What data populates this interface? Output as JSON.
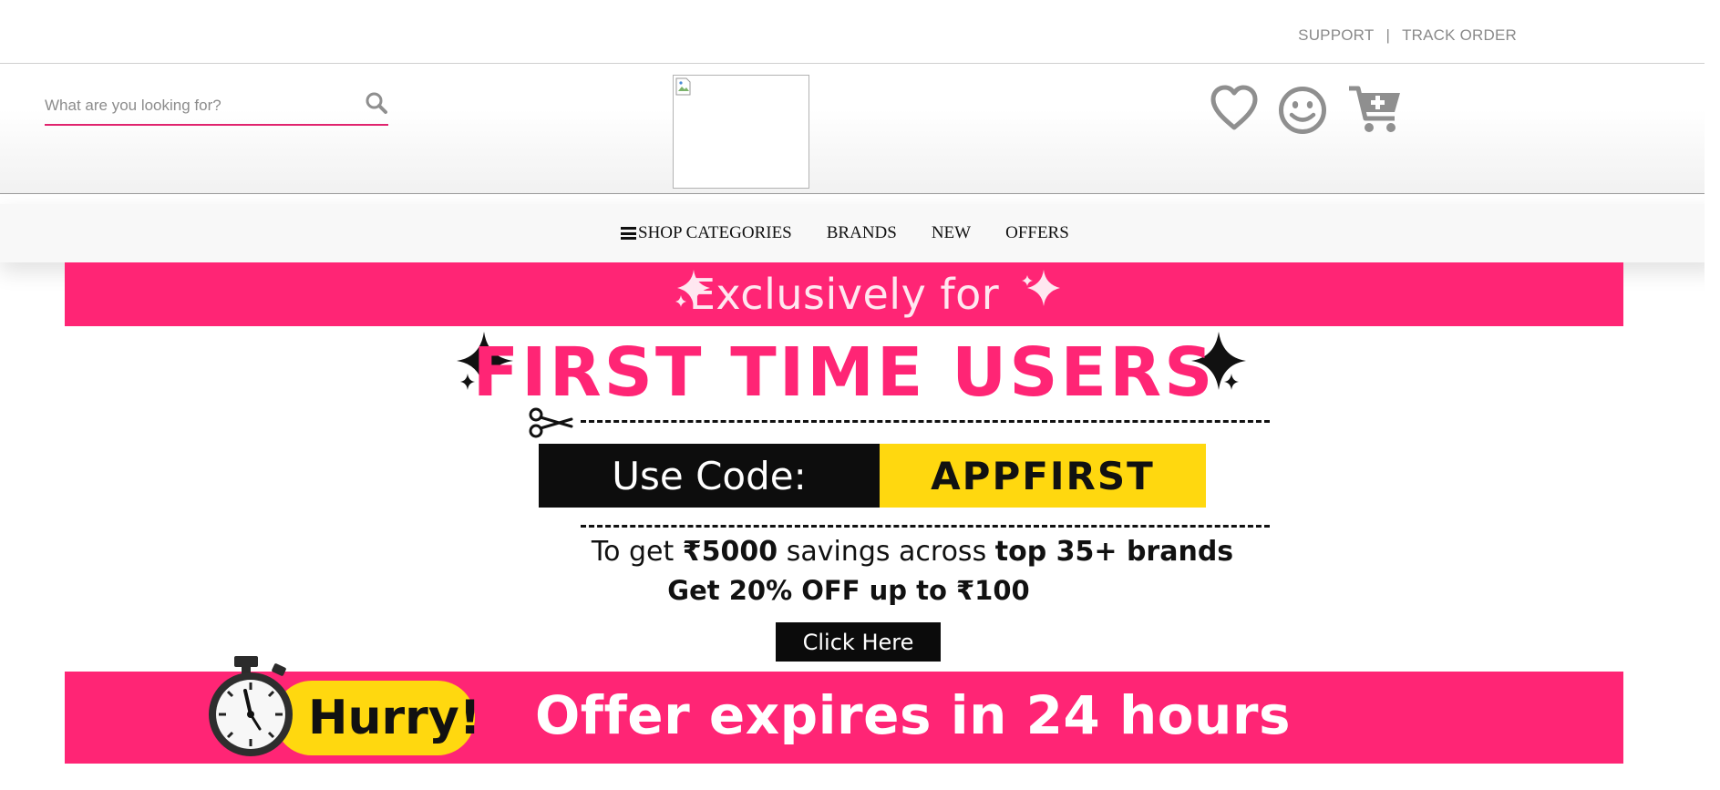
{
  "topbar": {
    "support_label": "SUPPORT",
    "separator": "|",
    "track_order_label": "TRACK ORDER"
  },
  "header": {
    "search_placeholder": "What are you looking for?",
    "icons": [
      "search-icon",
      "heart-icon",
      "smiley-icon",
      "cart-add-icon"
    ]
  },
  "nav": {
    "items": [
      {
        "label": "SHOP CATEGORIES",
        "icon": "hamburger-icon"
      },
      {
        "label": "BRANDS"
      },
      {
        "label": "NEW"
      },
      {
        "label": "OFFERS"
      }
    ]
  },
  "banner": {
    "top_text": "Exclusively for",
    "headline": "FIRST TIME USERS",
    "code_label": "Use Code:",
    "code_value": "APPFIRST",
    "savings_prefix": "To get",
    "savings_amount": "₹5000",
    "savings_middle": "savings across",
    "savings_suffix": "top 35+ brands",
    "discount_text": "Get 20% OFF up to ₹100",
    "cta_label": "Click Here",
    "hurry_text": "Hurry!",
    "offer_text": "Offer expires in 24 hours",
    "colors": {
      "pink": "#ff2575",
      "yellow": "#ffd80f",
      "black": "#0d0d0d"
    }
  }
}
